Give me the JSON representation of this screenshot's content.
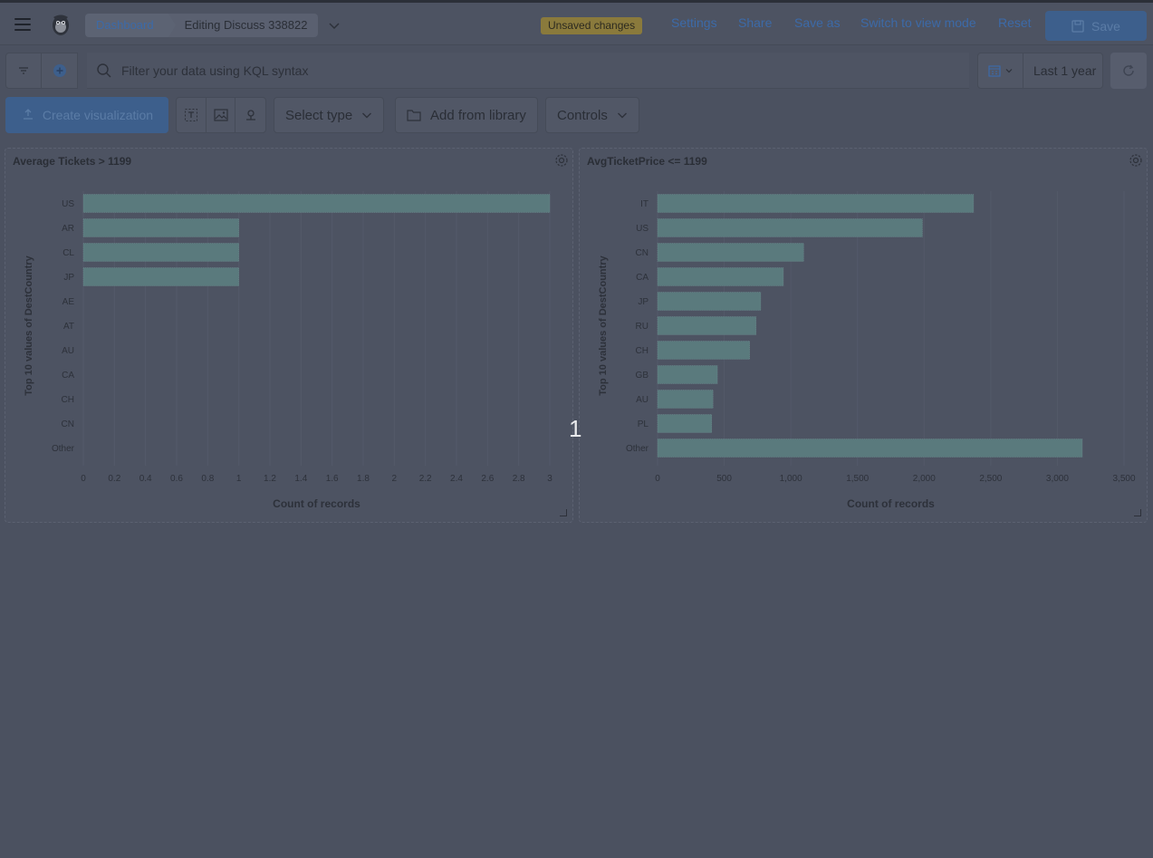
{
  "header": {
    "breadcrumbs": [
      "Dashboard",
      "Editing Discuss 338822"
    ],
    "unsaved_badge": "Unsaved changes",
    "links": [
      "Settings",
      "Share",
      "Save as",
      "Switch to view mode",
      "Reset"
    ],
    "save_label": "Save"
  },
  "query": {
    "placeholder": "Filter your data using KQL syntax",
    "time_range": "Last 1 year"
  },
  "toolbar": {
    "create_label": "Create visualization",
    "select_type_label": "Select type",
    "add_library_label": "Add from library",
    "controls_label": "Controls"
  },
  "divider_number": "1",
  "colors": {
    "bar": "#5a7a7d",
    "accent": "#3d5f8c",
    "background": "#4b5160"
  },
  "chart_data": [
    {
      "type": "bar",
      "orientation": "horizontal",
      "title": "Average Tickets > 1199",
      "xlabel": "Count of records",
      "ylabel": "Top 10 values of DestCountry",
      "categories": [
        "US",
        "AR",
        "CL",
        "JP",
        "AE",
        "AT",
        "AU",
        "CA",
        "CH",
        "CN",
        "Other"
      ],
      "values": [
        3,
        1,
        1,
        1,
        0,
        0,
        0,
        0,
        0,
        0,
        0
      ],
      "xlim": [
        0,
        3
      ],
      "xticks": [
        0,
        0.2,
        0.4,
        0.6,
        0.8,
        1,
        1.2,
        1.4,
        1.6,
        1.8,
        2,
        2.2,
        2.4,
        2.6,
        2.8,
        3
      ],
      "xtick_labels": [
        "0",
        "0.2",
        "0.4",
        "0.6",
        "0.8",
        "1",
        "1.2",
        "1.4",
        "1.6",
        "1.8",
        "2",
        "2.2",
        "2.4",
        "2.6",
        "2.8",
        "3"
      ],
      "grid": true
    },
    {
      "type": "bar",
      "orientation": "horizontal",
      "title": "AvgTicketPrice <= 1199",
      "xlabel": "Count of records",
      "ylabel": "Top 10 values of DestCountry",
      "categories": [
        "IT",
        "US",
        "CN",
        "CA",
        "JP",
        "RU",
        "CH",
        "GB",
        "AU",
        "PL",
        "Other"
      ],
      "values": [
        2371,
        1987,
        1096,
        944,
        774,
        739,
        691,
        449,
        416,
        406,
        3187
      ],
      "xlim": [
        0,
        3500
      ],
      "xticks": [
        0,
        500,
        1000,
        1500,
        2000,
        2500,
        3000,
        3500
      ],
      "xtick_labels": [
        "0",
        "500",
        "1,000",
        "1,500",
        "2,000",
        "2,500",
        "3,000",
        "3,500"
      ],
      "grid": true
    }
  ]
}
